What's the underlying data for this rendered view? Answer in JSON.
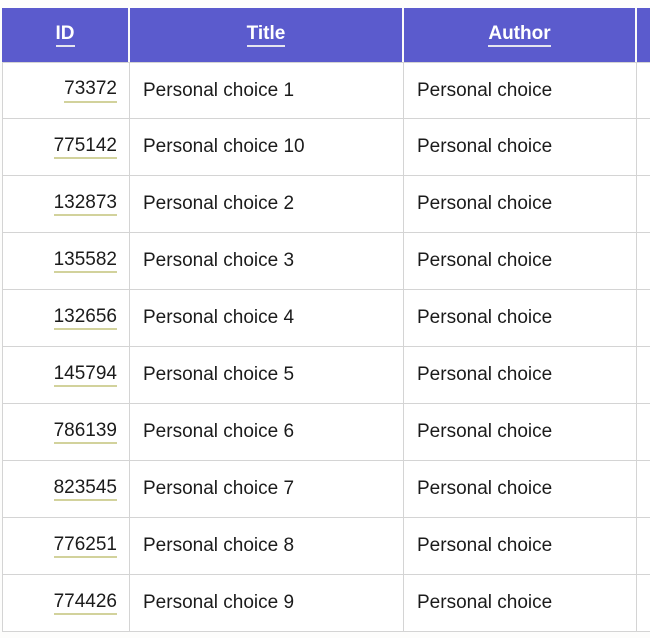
{
  "table": {
    "name": "records-table",
    "columns": [
      {
        "key": "id",
        "label": "ID",
        "align": "right",
        "link": true
      },
      {
        "key": "title",
        "label": "Title",
        "align": "left",
        "link": false
      },
      {
        "key": "author",
        "label": "Author",
        "align": "left",
        "link": false
      },
      {
        "key": "extra",
        "label": "",
        "align": "left",
        "link": false
      }
    ],
    "rows": [
      {
        "id": "73372",
        "title": "Personal choice 1",
        "author": "Personal choice",
        "extra": ""
      },
      {
        "id": "775142",
        "title": "Personal choice 10",
        "author": "Personal choice",
        "extra": ""
      },
      {
        "id": "132873",
        "title": "Personal choice 2",
        "author": "Personal choice",
        "extra": ""
      },
      {
        "id": "135582",
        "title": "Personal choice 3",
        "author": "Personal choice",
        "extra": ""
      },
      {
        "id": "132656",
        "title": "Personal choice 4",
        "author": "Personal choice",
        "extra": ""
      },
      {
        "id": "145794",
        "title": "Personal choice 5",
        "author": "Personal choice",
        "extra": ""
      },
      {
        "id": "786139",
        "title": "Personal choice 6",
        "author": "Personal choice",
        "extra": ""
      },
      {
        "id": "823545",
        "title": "Personal choice 7",
        "author": "Personal choice",
        "extra": ""
      },
      {
        "id": "776251",
        "title": "Personal choice 8",
        "author": "Personal choice",
        "extra": ""
      },
      {
        "id": "774426",
        "title": "Personal choice 9",
        "author": "Personal choice",
        "extra": ""
      }
    ]
  },
  "colors": {
    "header_background": "#5b5bcd",
    "header_text": "#ffffff",
    "header_underline": "#e4e4ef",
    "cell_text": "#1b1b1b",
    "id_link_underline": "#d2d29c",
    "grid_line": "#d4d4d4",
    "page_background": "#ffffff"
  }
}
